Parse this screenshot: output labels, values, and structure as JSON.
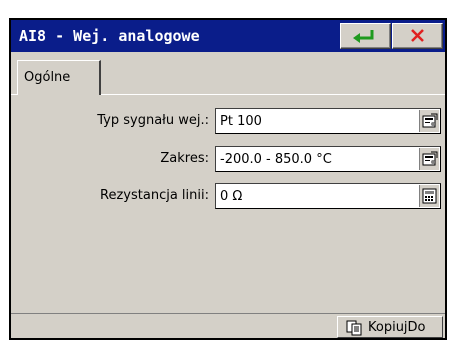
{
  "dialog": {
    "title": "AI8 - Wej. analogowe",
    "ok_icon": "enter-arrow-icon",
    "close_icon": "close-x-icon",
    "colors": {
      "titlebar": "#0a1d8a",
      "ok_arrow": "#1f9a1f",
      "close_x": "#e02020",
      "face": "#d4d0c8"
    }
  },
  "tabs": [
    {
      "label": "Ogólne"
    }
  ],
  "fields": [
    {
      "label": "Typ sygnału wej.:",
      "value": "Pt 100",
      "button_icon": "properties-icon"
    },
    {
      "label": "Zakres:",
      "value": "-200.0 - 850.0 °C",
      "button_icon": "properties-icon"
    },
    {
      "label": "Rezystancja linii:",
      "value": "0 Ω",
      "button_icon": "keypad-icon"
    }
  ],
  "footer": {
    "copy_label": "KopiujDo",
    "copy_icon": "copy-pages-icon"
  }
}
